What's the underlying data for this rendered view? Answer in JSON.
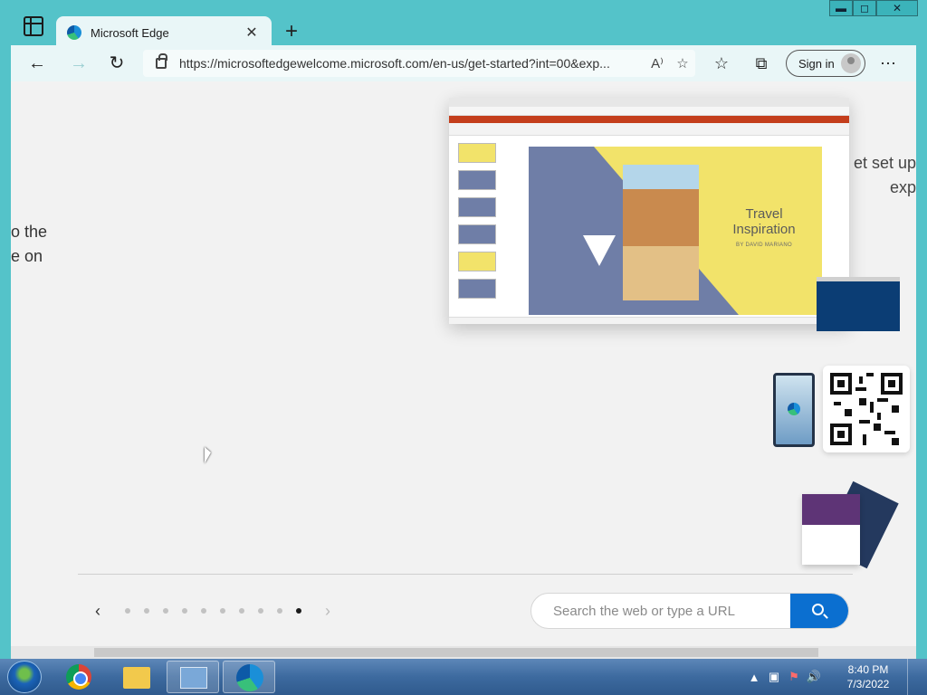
{
  "browser": {
    "tab_title": "Microsoft Edge",
    "tab_close": "✕",
    "new_tab": "+",
    "url": "https://microsoftedgewelcome.microsoft.com/en-us/get-started?int=00&exp...",
    "signin_label": "Sign in",
    "window_controls": {
      "minimize": "▬",
      "maximize": "◻",
      "close": "✕"
    },
    "nav": {
      "back": "←",
      "forward": "→",
      "refresh": "↻"
    },
    "addr_icons": {
      "read_aloud": "A⁾",
      "add_favorite": "☆"
    },
    "toolbar_icons": {
      "favorites": "☆",
      "collections": "⧉",
      "more": "⋯"
    }
  },
  "page": {
    "left_fragments": [
      "o the",
      "e on"
    ],
    "right_fragments": [
      "et set up",
      "exp"
    ],
    "preview": {
      "slide_title": "Travel Inspiration",
      "slide_byline": "BY DAVID MARIANO"
    },
    "pager": {
      "prev": "‹",
      "next": "›",
      "dot_count": 10,
      "active_index": 9
    },
    "search_placeholder": "Search the web or type a URL"
  },
  "taskbar": {
    "time": "8:40 PM",
    "date": "7/3/2022",
    "tray_icons": [
      "▲",
      "▣",
      "⚑",
      "🔊"
    ]
  }
}
